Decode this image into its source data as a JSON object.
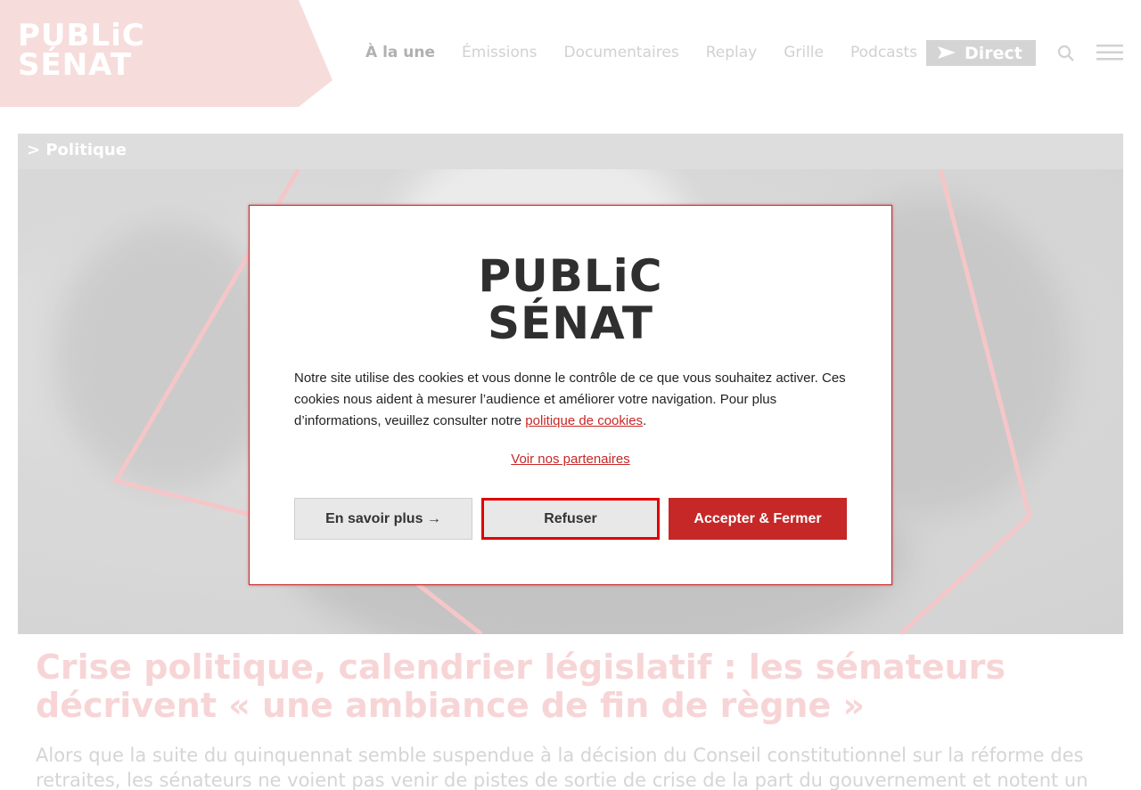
{
  "header": {
    "logo": {
      "line1": "PUBLiC",
      "line2": "SÉNAT"
    },
    "nav": [
      {
        "label": "À la une",
        "active": true
      },
      {
        "label": "Émissions",
        "active": false
      },
      {
        "label": "Documentaires",
        "active": false
      },
      {
        "label": "Replay",
        "active": false
      },
      {
        "label": "Grille",
        "active": false
      },
      {
        "label": "Podcasts",
        "active": false
      }
    ],
    "direct_label": "Direct",
    "icons": {
      "search": "search-icon",
      "menu": "hamburger-menu-icon",
      "play": "play-arrow-icon"
    }
  },
  "article": {
    "category": "> Politique",
    "title": "Crise politique, calendrier législatif : les sénateurs décrivent « une ambiance de fin de règne »",
    "lead": "Alors que la suite du quinquennat semble suspendue à la décision du Conseil constitutionnel sur la réforme des retraites, les sénateurs ne voient pas venir de pistes de sortie de crise de la part du gouvernement et notent un"
  },
  "cookie_modal": {
    "logo": {
      "line1": "PUBLiC",
      "line2": "SÉNAT"
    },
    "text_before_link": "Notre site utilise des cookies et vous donne le contrôle de ce que vous souhaitez activer. Ces cookies nous aident à mesurer l’audience et améliorer votre navigation. Pour plus d’informations, veuillez consulter notre ",
    "policy_link": "politique de cookies",
    "text_after_link": ".",
    "partners_link": "Voir nos partenaires",
    "buttons": {
      "more": "En savoir plus →",
      "refuse": "Refuser",
      "accept": "Accepter & Fermer"
    }
  },
  "colors": {
    "brand_red": "#c62828",
    "header_pink": "#f5d3d3",
    "focus_outline": "#e00000"
  }
}
